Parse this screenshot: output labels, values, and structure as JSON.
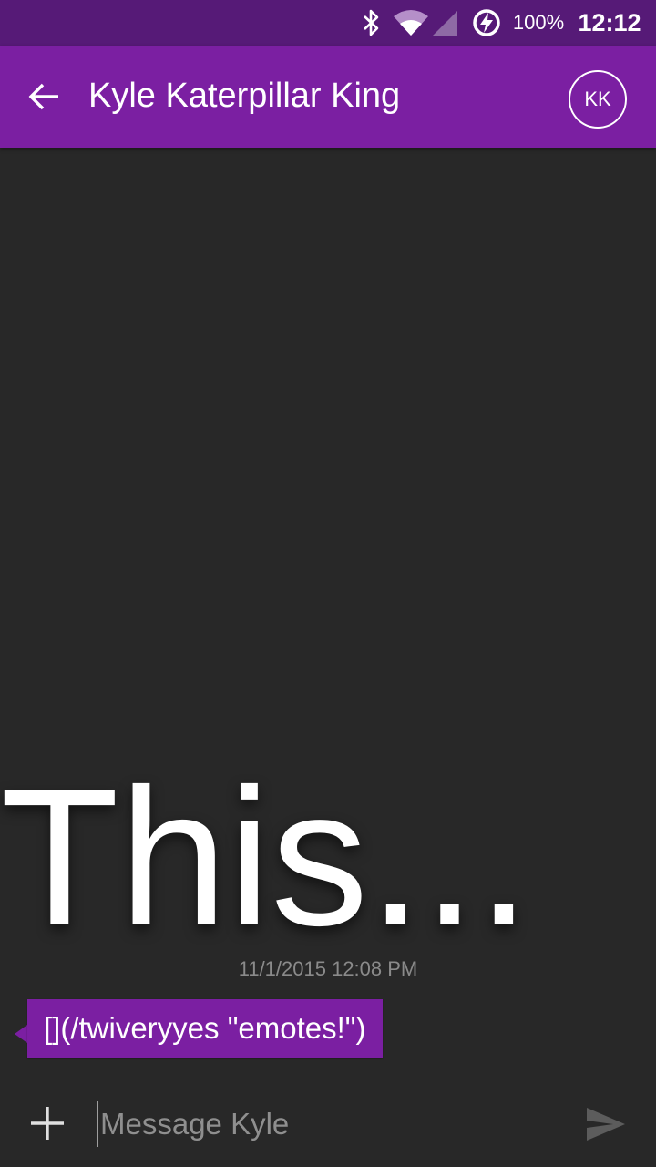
{
  "status_bar": {
    "battery_percent": "100%",
    "time": "12:12",
    "icons": [
      "bluetooth-icon",
      "wifi-icon",
      "cell-signal-icon",
      "battery-saver-icon"
    ]
  },
  "app_bar": {
    "back_icon": "arrow-back-icon",
    "title": "Kyle Katerpillar King",
    "avatar_initials": "KK"
  },
  "conversation": {
    "messages": [
      {
        "text": "This...",
        "timestamp": "11/1/2015 12:08 PM"
      },
      {
        "text": "[](/twiveryyes \"emotes!\")"
      }
    ]
  },
  "composer": {
    "attach_icon": "plus-icon",
    "placeholder": "Message Kyle",
    "value": "",
    "send_icon": "send-icon"
  },
  "colors": {
    "status_bar": "#561a77",
    "app_bar": "#7b1fa2",
    "background": "#282828",
    "bubble": "#7b1fa2",
    "timestamp": "#8a8a8a"
  }
}
